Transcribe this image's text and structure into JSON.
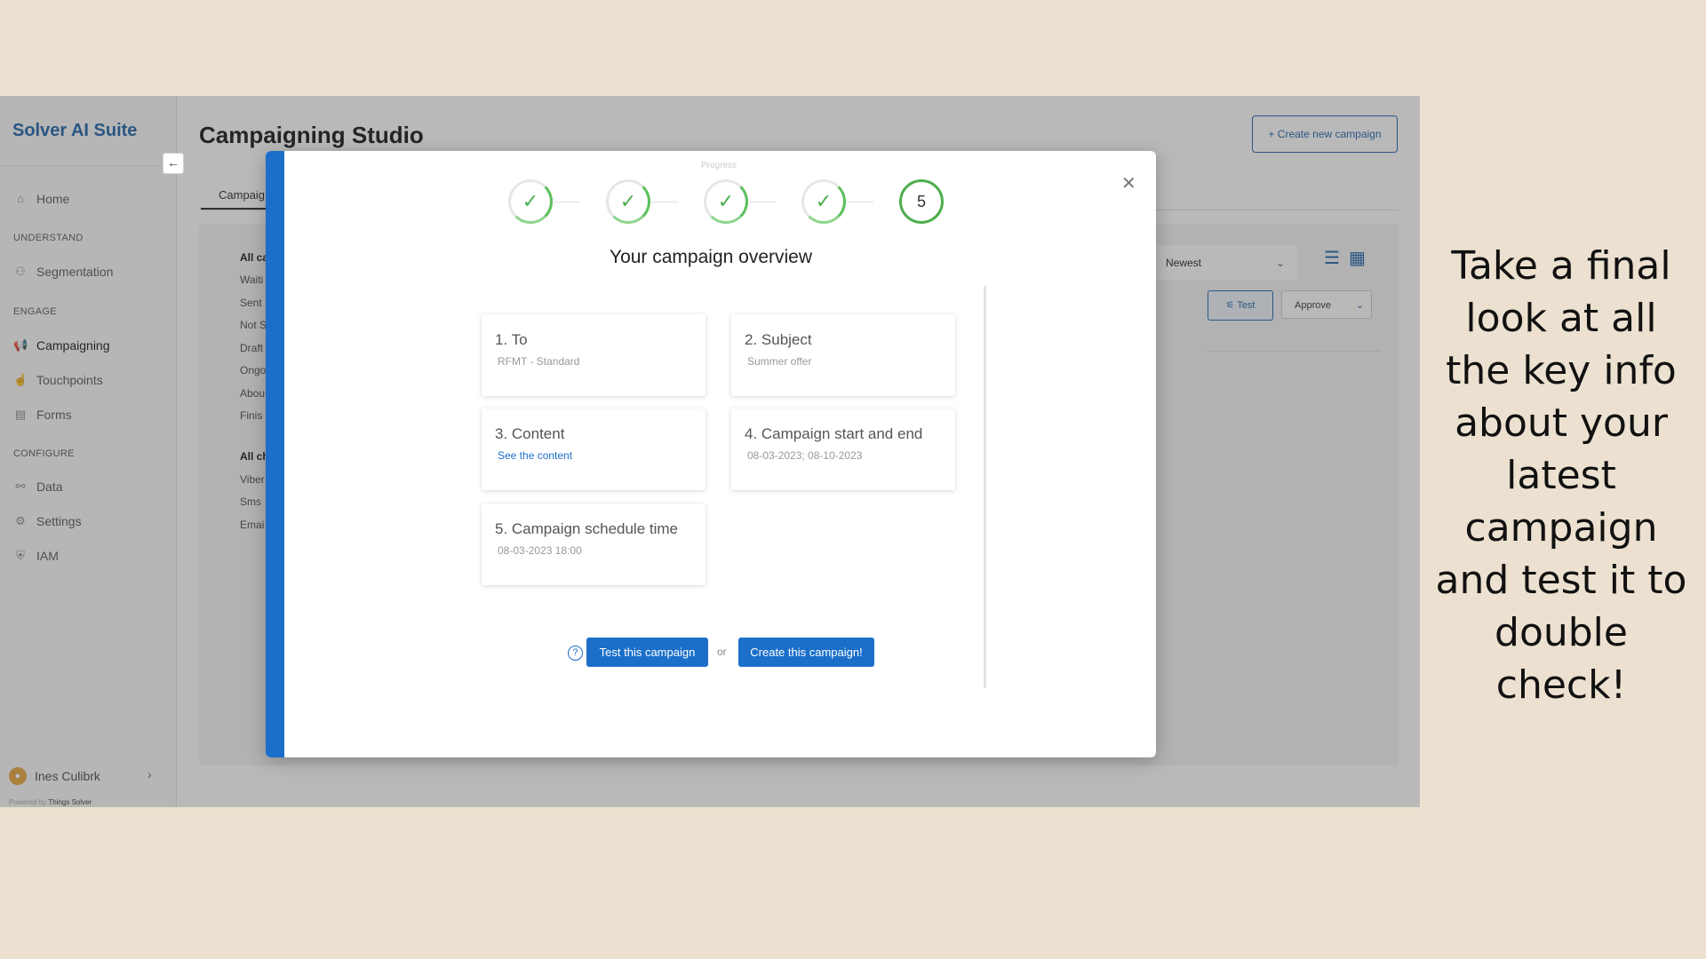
{
  "sidebar": {
    "brand": "Solver AI Suite",
    "items": [
      {
        "label": "Home",
        "icon": "home-icon"
      },
      {
        "section": "UNDERSTAND"
      },
      {
        "label": "Segmentation",
        "icon": "people-icon"
      },
      {
        "section": "ENGAGE"
      },
      {
        "label": "Campaigning",
        "icon": "megaphone-icon",
        "active": true
      },
      {
        "label": "Touchpoints",
        "icon": "hand-icon"
      },
      {
        "label": "Forms",
        "icon": "clipboard-icon"
      },
      {
        "section": "CONFIGURE"
      },
      {
        "label": "Data",
        "icon": "share-icon"
      },
      {
        "label": "Settings",
        "icon": "sliders-icon"
      },
      {
        "label": "IAM",
        "icon": "shield-icon"
      }
    ],
    "user": "Ines Culibrk",
    "powered_prefix": "Powered by",
    "powered_brand": "Things Solver"
  },
  "main": {
    "title": "Campaigning Studio",
    "create_button": "+ Create new campaign",
    "tab": "Campaig",
    "filters_status": [
      "All ca",
      "Waiti",
      "Sent",
      "Not S",
      "Draft",
      "Ongo",
      "Abou",
      "Finis"
    ],
    "filters_channel": [
      "All ch",
      "Viber",
      "Sms",
      "Emai"
    ],
    "sort_value": "Newest",
    "test_label": "Test",
    "approve_label": "Approve"
  },
  "modal": {
    "progress_label": "Progress",
    "steps": [
      "✓",
      "✓",
      "✓",
      "✓",
      "5"
    ],
    "title": "Your campaign overview",
    "cards": [
      {
        "title": "1. To",
        "value": "RFMT - Standard"
      },
      {
        "title": "2. Subject",
        "value": "Summer offer"
      },
      {
        "title": "3. Content",
        "value": "See the content"
      },
      {
        "title": "4. Campaign start and end",
        "value": "08-03-2023; 08-10-2023"
      },
      {
        "title": "5. Campaign schedule time",
        "value": "08-03-2023 18:00"
      }
    ],
    "test_button": "Test this campaign",
    "or": "or",
    "create_button": "Create this campaign!"
  },
  "caption": "Take a final look at all the key info about your latest campaign and test it to double check!",
  "colors": {
    "accent": "#1b6fc9",
    "success": "#4cae4c",
    "background": "#ece1d0"
  }
}
